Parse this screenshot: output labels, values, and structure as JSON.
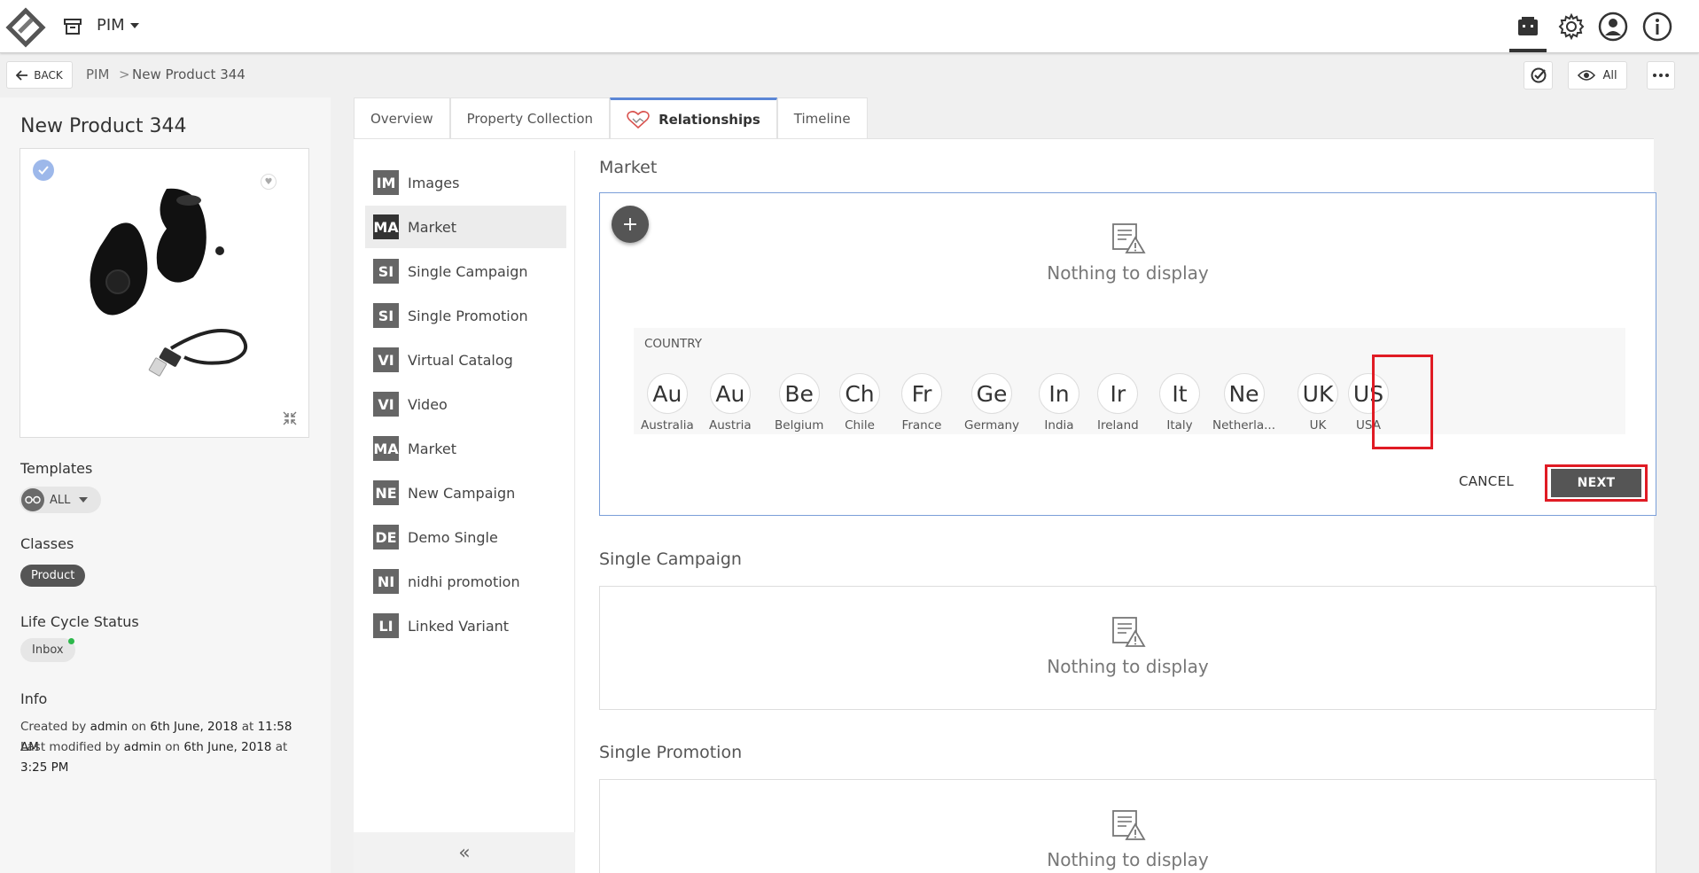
{
  "app": {
    "module_label": "PIM",
    "icons": {
      "logo": "app-logo",
      "module": "archive-box-icon",
      "top_right": [
        "kanban-board-icon",
        "gear-icon",
        "user-circle-icon",
        "info-icon"
      ]
    }
  },
  "header": {
    "back_label": "BACK",
    "breadcrumb": [
      "PIM",
      "New Product 344"
    ],
    "breadcrumb_separator": ">",
    "view_label": "All"
  },
  "product": {
    "title": "New Product 344",
    "templates_label": "Templates",
    "template_value": "ALL",
    "classes_label": "Classes",
    "class_value": "Product",
    "lifecycle_label": "Life Cycle Status",
    "lifecycle_value": "Inbox",
    "info_label": "Info",
    "created_prefix": "Created by",
    "created_by": "admin",
    "created_on_word": "on",
    "created_date": "6th June, 2018",
    "created_at_word": "at",
    "created_time": "11:58 AM",
    "modified_prefix": "Last modified by",
    "modified_by": "admin",
    "modified_on_word": "on",
    "modified_date": "6th June, 2018",
    "modified_at_word": "at",
    "modified_time": "3:25 PM"
  },
  "tabs": [
    {
      "label": "Overview"
    },
    {
      "label": "Property Collection"
    },
    {
      "label": "Relationships"
    },
    {
      "label": "Timeline"
    }
  ],
  "relationships": [
    {
      "abbr": "IM",
      "label": "Images"
    },
    {
      "abbr": "MA",
      "label": "Market"
    },
    {
      "abbr": "SI",
      "label": "Single Campaign"
    },
    {
      "abbr": "SI",
      "label": "Single Promotion"
    },
    {
      "abbr": "VI",
      "label": "Virtual Catalog"
    },
    {
      "abbr": "VI",
      "label": "Video"
    },
    {
      "abbr": "MA",
      "label": "Market"
    },
    {
      "abbr": "NE",
      "label": "New Campaign"
    },
    {
      "abbr": "DE",
      "label": "Demo Single"
    },
    {
      "abbr": "NI",
      "label": "nidhi promotion"
    },
    {
      "abbr": "LI",
      "label": "Linked Variant"
    }
  ],
  "collapse_glyph": "«",
  "sections": {
    "market_title": "Market",
    "single_campaign_title": "Single Campaign",
    "single_promotion_title": "Single Promotion",
    "empty_text": "Nothing to display",
    "add_glyph": "+"
  },
  "country_selector": {
    "label": "COUNTRY",
    "countries": [
      {
        "abbr": "Au",
        "name": "Australia"
      },
      {
        "abbr": "Au",
        "name": "Austria"
      },
      {
        "abbr": "Be",
        "name": "Belgium"
      },
      {
        "abbr": "Ch",
        "name": "Chile"
      },
      {
        "abbr": "Fr",
        "name": "France"
      },
      {
        "abbr": "Ge",
        "name": "Germany"
      },
      {
        "abbr": "In",
        "name": "India"
      },
      {
        "abbr": "Ir",
        "name": "Ireland"
      },
      {
        "abbr": "It",
        "name": "Italy"
      },
      {
        "abbr": "Ne",
        "name": "Netherla..."
      },
      {
        "abbr": "UK",
        "name": "UK"
      },
      {
        "abbr": "US",
        "name": "USA"
      }
    ],
    "cancel_label": "CANCEL",
    "next_label": "NEXT"
  },
  "colors": {
    "accent_blue": "#5b86d6",
    "highlight_red": "#e01b24",
    "dark_button": "#555555",
    "status_green": "#2db84b"
  }
}
